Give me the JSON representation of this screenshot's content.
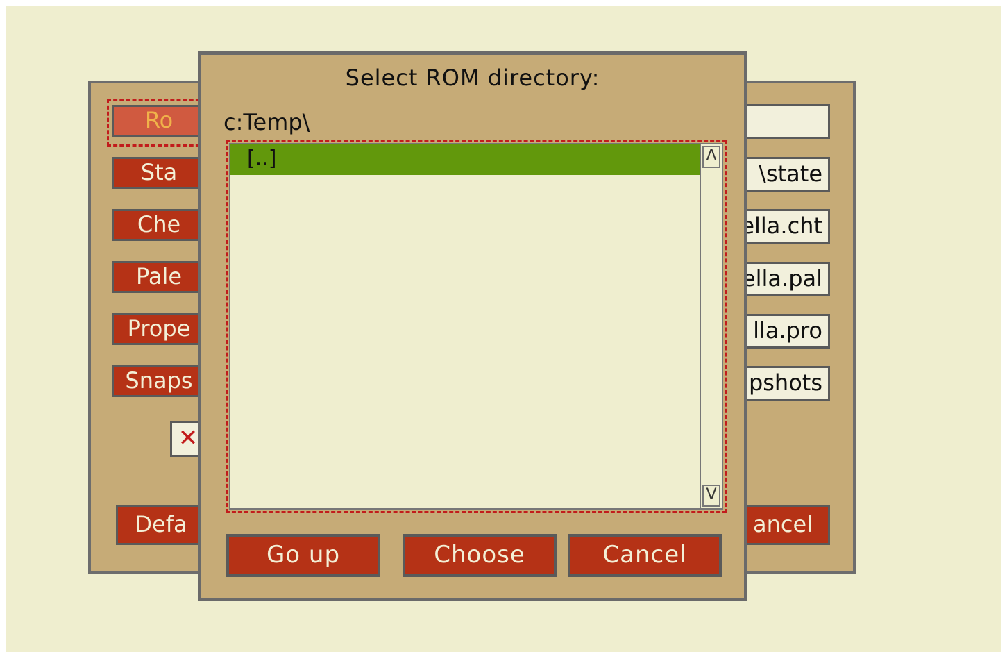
{
  "back_dialog": {
    "buttons": [
      {
        "label": "Ro"
      },
      {
        "label": "Sta"
      },
      {
        "label": "Che"
      },
      {
        "label": "Pale"
      },
      {
        "label": "Prope"
      },
      {
        "label": "Snaps"
      }
    ],
    "fields": [
      {
        "value": ""
      },
      {
        "value": "\\state"
      },
      {
        "value": "ella.cht"
      },
      {
        "value": "ella.pal"
      },
      {
        "value": "lla.pro"
      },
      {
        "value": "pshots"
      }
    ],
    "checkbox_mark": "✕",
    "defaults_label": "Defa",
    "cancel_label": "ancel"
  },
  "dialog": {
    "title": "Select ROM directory:",
    "path": "c:Temp\\",
    "items": [
      {
        "label": "[..]",
        "selected": true
      }
    ],
    "scroll_up": "Λ",
    "scroll_down": "V",
    "buttons": {
      "go_up": "Go up",
      "choose": "Choose",
      "cancel": "Cancel"
    }
  },
  "colors": {
    "background": "#efeecf",
    "dialog": "#c6ab77",
    "button": "#b53216",
    "selection": "#62980c",
    "focus": "#c21c1c"
  }
}
